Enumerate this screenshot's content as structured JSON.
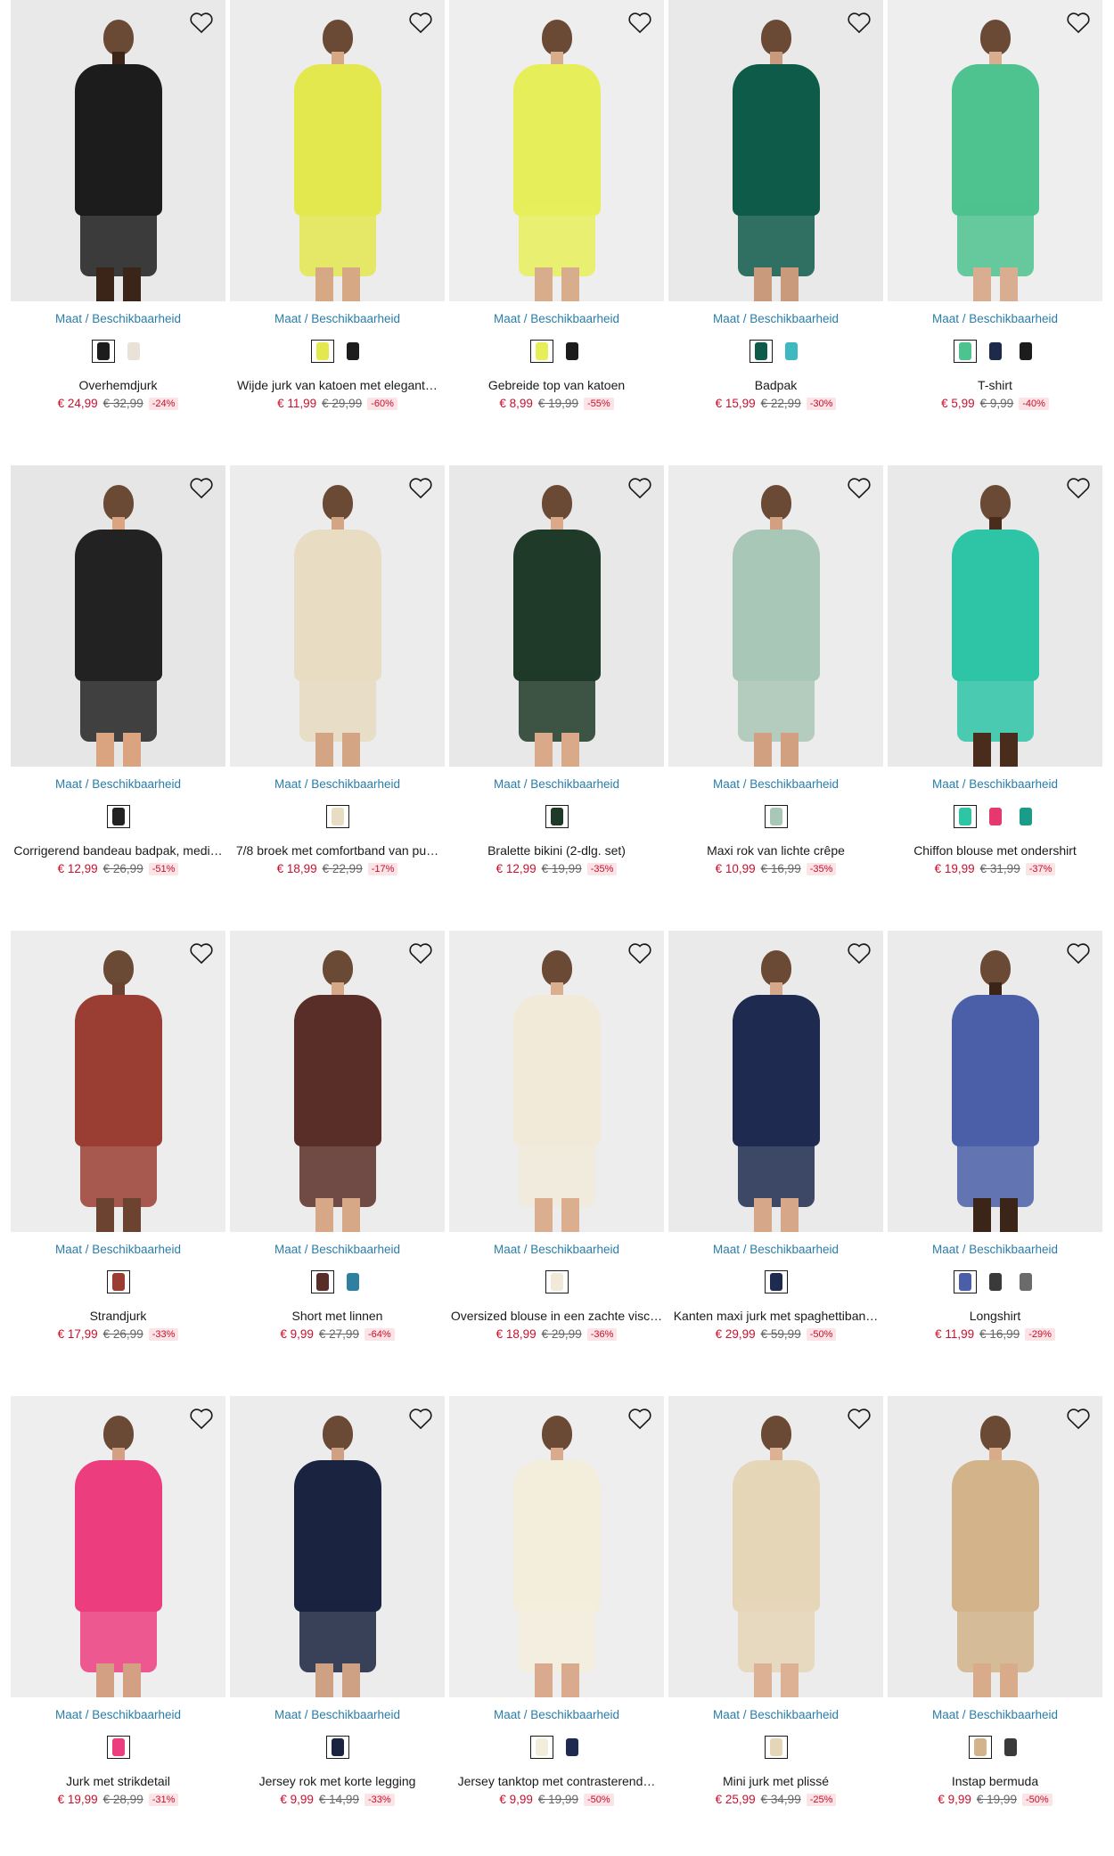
{
  "size_link_label": "Maat / Beschikbaarheid",
  "colors": {
    "price": "#c8102e",
    "link": "#2a7da8",
    "discount_bg": "#fbe3e6"
  },
  "products": [
    {
      "name": "Overhemdjurk",
      "price": "€ 24,99",
      "old_price": "€ 32,99",
      "discount": "-24%",
      "garment": "#1c1c1c",
      "bg": "#e9e9e9",
      "skin": "#3b2418",
      "swatches": [
        "#1c1c1c",
        "#e9e2d8"
      ]
    },
    {
      "name": "Wijde jurk van katoen met elegant…",
      "price": "€ 11,99",
      "old_price": "€ 29,99",
      "discount": "-60%",
      "garment": "#e4e84f",
      "bg": "#ececec",
      "skin": "#d6a884",
      "swatches": [
        "#e4e84f",
        "#1c1c1c"
      ]
    },
    {
      "name": "Gebreide top van katoen",
      "price": "€ 8,99",
      "old_price": "€ 19,99",
      "discount": "-55%",
      "garment": "#e6ee5a",
      "bg": "#eeeeee",
      "skin": "#d8ad8c",
      "swatches": [
        "#e6ee5a",
        "#1c1c1c"
      ]
    },
    {
      "name": "Badpak",
      "price": "€ 15,99",
      "old_price": "€ 22,99",
      "discount": "-30%",
      "garment": "#0f5b4a",
      "bg": "#e9e9e9",
      "skin": "#c99a7c",
      "swatches": [
        "#0f5b4a",
        "#3fb9c0"
      ]
    },
    {
      "name": "T-shirt",
      "price": "€ 5,99",
      "old_price": "€ 9,99",
      "discount": "-40%",
      "garment": "#4ec28f",
      "bg": "#eeeeee",
      "skin": "#d9ae90",
      "swatches": [
        "#4ec28f",
        "#1e2a4a",
        "#1c1c1c"
      ]
    },
    {
      "name": "Corrigerend bandeau badpak, medi…",
      "price": "€ 12,99",
      "old_price": "€ 26,99",
      "discount": "-51%",
      "garment": "#222222",
      "bg": "#e6e6e6",
      "skin": "#d9a47f",
      "swatches": [
        "#222222"
      ]
    },
    {
      "name": "7/8 broek met comfortband van pu…",
      "price": "€ 18,99",
      "old_price": "€ 22,99",
      "discount": "-17%",
      "garment": "#e8dcc2",
      "bg": "#ececec",
      "skin": "#d3a585",
      "swatches": [
        "#e8dcc2"
      ]
    },
    {
      "name": "Bralette bikini (2-dlg. set)",
      "price": "€ 12,99",
      "old_price": "€ 19,99",
      "discount": "-35%",
      "garment": "#1f3a28",
      "bg": "#e8e8e8",
      "skin": "#d9a98a",
      "swatches": [
        "#1f3a28"
      ]
    },
    {
      "name": "Maxi rok van lichte crêpe",
      "price": "€ 10,99",
      "old_price": "€ 16,99",
      "discount": "-35%",
      "garment": "#a9c7b6",
      "bg": "#ececec",
      "skin": "#d1a081",
      "swatches": [
        "#a9c7b6"
      ]
    },
    {
      "name": "Chiffon blouse met ondershirt",
      "price": "€ 19,99",
      "old_price": "€ 31,99",
      "discount": "-37%",
      "garment": "#2ec4a6",
      "bg": "#e9e9e9",
      "skin": "#4a2c1d",
      "swatches": [
        "#2ec4a6",
        "#e6386f",
        "#1a9c88"
      ]
    },
    {
      "name": "Strandjurk",
      "price": "€ 17,99",
      "old_price": "€ 26,99",
      "discount": "-33%",
      "garment": "#9a3d33",
      "bg": "#ededed",
      "skin": "#6b4330",
      "swatches": [
        "#9a3d33"
      ]
    },
    {
      "name": "Short met linnen",
      "price": "€ 9,99",
      "old_price": "€ 27,99",
      "discount": "-64%",
      "garment": "#5a2e28",
      "bg": "#ececec",
      "skin": "#d6a888",
      "swatches": [
        "#5a2e28",
        "#2f7fa0"
      ]
    },
    {
      "name": "Oversized blouse in een zachte visc…",
      "price": "€ 18,99",
      "old_price": "€ 29,99",
      "discount": "-36%",
      "garment": "#f1ead9",
      "bg": "#ededed",
      "skin": "#dcae90",
      "swatches": [
        "#f1ead9"
      ]
    },
    {
      "name": "Kanten maxi jurk met spaghettiban…",
      "price": "€ 29,99",
      "old_price": "€ 59,99",
      "discount": "-50%",
      "garment": "#1e2a4f",
      "bg": "#eaeaea",
      "skin": "#d6a789",
      "swatches": [
        "#1e2a4f"
      ]
    },
    {
      "name": "Longshirt",
      "price": "€ 11,99",
      "old_price": "€ 16,99",
      "discount": "-29%",
      "garment": "#4b5fa8",
      "bg": "#ebebeb",
      "skin": "#3b2418",
      "swatches": [
        "#4b5fa8",
        "#3a3a3a",
        "#6b6b6b"
      ]
    },
    {
      "name": "Jurk met strikdetail",
      "price": "€ 19,99",
      "old_price": "€ 28,99",
      "discount": "-31%",
      "garment": "#ec3d7f",
      "bg": "#eeeeee",
      "skin": "#d3a083",
      "swatches": [
        "#ec3d7f"
      ]
    },
    {
      "name": "Jersey rok met korte legging",
      "price": "€ 9,99",
      "old_price": "€ 14,99",
      "discount": "-33%",
      "garment": "#1a2340",
      "bg": "#ececec",
      "skin": "#cfa184",
      "swatches": [
        "#1a2340"
      ]
    },
    {
      "name": "Jersey tanktop met contrasterend…",
      "price": "€ 9,99",
      "old_price": "€ 19,99",
      "discount": "-50%",
      "garment": "#f3eddc",
      "bg": "#eeeeee",
      "skin": "#d9aa8d",
      "swatches": [
        "#f3eddc",
        "#1e2a4f"
      ]
    },
    {
      "name": "Mini jurk met plissé",
      "price": "€ 25,99",
      "old_price": "€ 34,99",
      "discount": "-25%",
      "garment": "#e6d6b8",
      "bg": "#ececec",
      "skin": "#ddb193",
      "swatches": [
        "#e6d6b8"
      ]
    },
    {
      "name": "Instap bermuda",
      "price": "€ 9,99",
      "old_price": "€ 19,99",
      "discount": "-50%",
      "garment": "#d2b38a",
      "bg": "#ebebeb",
      "skin": "#d8ab8a",
      "swatches": [
        "#d2b38a",
        "#3a3a3a"
      ]
    }
  ]
}
